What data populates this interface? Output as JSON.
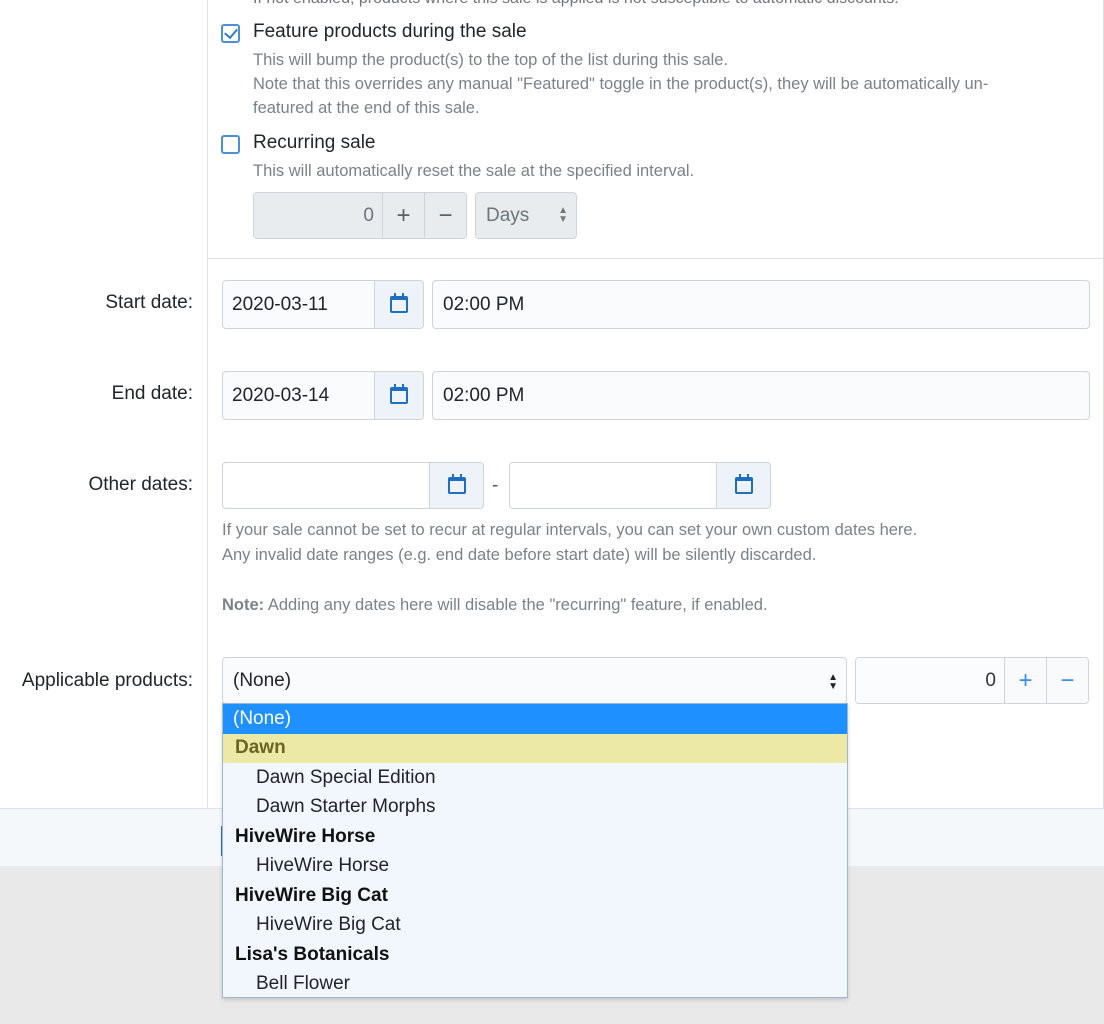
{
  "top_cut_text": "If not enabled, products where this sale is applied is not susceptible to automatic discounts.",
  "feature": {
    "checked": true,
    "label": "Feature products during the sale",
    "help1": "This will bump the product(s) to the top of the list during this sale.",
    "help2": "Note that this overrides any manual \"Featured\" toggle in the product(s), they will be automatically un-",
    "help3": "featured at the end of this sale."
  },
  "recurring": {
    "checked": false,
    "label": "Recurring sale",
    "help": "This will automatically reset the sale at the specified interval.",
    "interval_value": "0",
    "plus": "+",
    "minus": "−",
    "unit": "Days"
  },
  "start_date": {
    "label": "Start date:",
    "date": "2020-03-11",
    "time": "02:00 PM"
  },
  "end_date": {
    "label": "End date:",
    "date": "2020-03-14",
    "time": "02:00 PM"
  },
  "other_dates": {
    "label": "Other dates:",
    "separator": "-",
    "help1": "If your sale cannot be set to recur at regular intervals, you can set your own custom dates here.",
    "help2": "Any invalid date ranges (e.g. end date before start date) will be silently discarded.",
    "note_bold": "Note:",
    "note_text": " Adding any dates here will disable the \"recurring\" feature, if enabled."
  },
  "applicable": {
    "label": "Applicable products:",
    "selected": "(None)",
    "quantity": "0",
    "plus": "+",
    "minus": "−",
    "options": [
      {
        "label": "(None)",
        "kind": "selected"
      },
      {
        "label": "Dawn",
        "kind": "group-highlight"
      },
      {
        "label": "Dawn Special Edition",
        "kind": "child"
      },
      {
        "label": "Dawn Starter Morphs",
        "kind": "child"
      },
      {
        "label": "HiveWire Horse",
        "kind": "group"
      },
      {
        "label": "HiveWire Horse",
        "kind": "child"
      },
      {
        "label": "HiveWire Big Cat",
        "kind": "group"
      },
      {
        "label": "HiveWire Big Cat",
        "kind": "child"
      },
      {
        "label": "Lisa's Botanicals",
        "kind": "group"
      },
      {
        "label": "Bell Flower",
        "kind": "child"
      }
    ]
  },
  "colors": {
    "accent": "#1e90ff",
    "highlight": "#ece9a6",
    "icon_blue": "#1f6fbf"
  }
}
